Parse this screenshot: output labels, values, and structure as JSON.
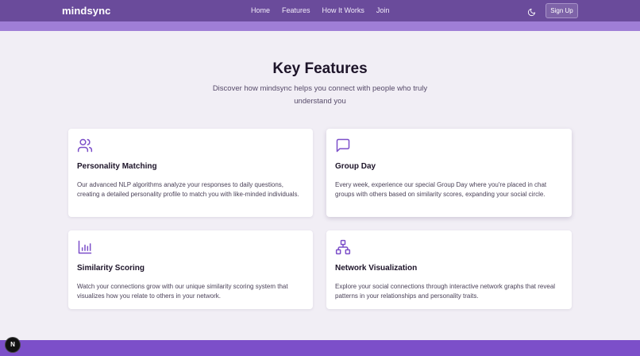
{
  "nav": {
    "brand": "mindsync",
    "links": [
      "Home",
      "Features",
      "How It Works",
      "Join"
    ],
    "signup_label": "Sign Up",
    "theme_icon": "moon-icon"
  },
  "features": {
    "title": "Key Features",
    "subtitle": "Discover how mindsync helps you connect with people who truly understand you",
    "cards": [
      {
        "icon": "users-icon",
        "title": "Personality Matching",
        "description": "Our advanced NLP algorithms analyze your responses to daily questions, creating a detailed personality profile to match you with like-minded individuals."
      },
      {
        "icon": "message-square-icon",
        "title": "Group Day",
        "description": "Every week, experience our special Group Day where you're placed in chat groups with others based on similarity scores, expanding your social circle."
      },
      {
        "icon": "bar-chart-icon",
        "title": "Similarity Scoring",
        "description": "Watch your connections grow with our unique similarity scoring system that visualizes how you relate to others in your network."
      },
      {
        "icon": "network-icon",
        "title": "Network Visualization",
        "description": "Explore your social connections through interactive network graphs that reveal patterns in your relationships and personality traits."
      }
    ]
  },
  "badge": {
    "label": "N"
  },
  "colors": {
    "navbar": "#6a4b9b",
    "accent_strip": "#9f7ed6",
    "icon_purple": "#7c4fc9",
    "footer": "#7c4fc9",
    "background": "#f1eef5"
  }
}
